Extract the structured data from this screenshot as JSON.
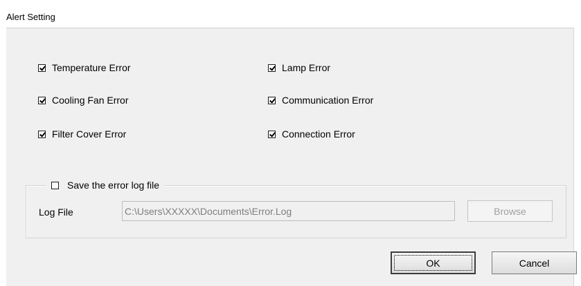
{
  "window": {
    "title": "Alert Setting"
  },
  "alerts": [
    {
      "label": "Temperature Error",
      "checked": true
    },
    {
      "label": "Lamp Error",
      "checked": true
    },
    {
      "label": "Cooling Fan Error",
      "checked": true
    },
    {
      "label": "Communication Error",
      "checked": true
    },
    {
      "label": "Filter Cover Error",
      "checked": true
    },
    {
      "label": "Connection Error",
      "checked": true
    }
  ],
  "log": {
    "save_label": "Save the error log file",
    "save_checked": false,
    "file_label": "Log File",
    "file_value": "C:\\Users\\XXXXX\\Documents\\Error.Log",
    "browse_label": "Browse"
  },
  "buttons": {
    "ok_label": "OK",
    "cancel_label": "Cancel"
  }
}
